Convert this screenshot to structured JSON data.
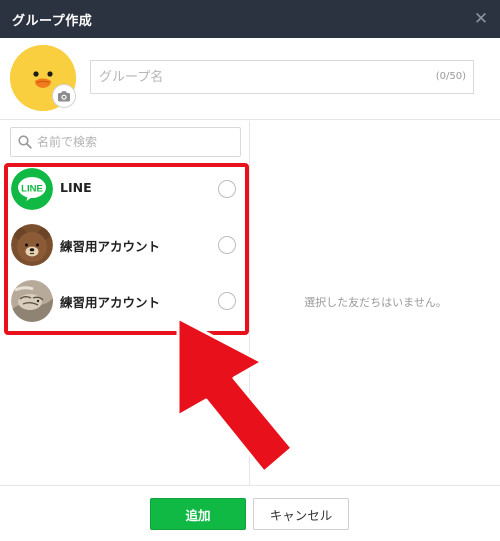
{
  "window": {
    "title": "グループ作成",
    "close_glyph": "✕"
  },
  "group": {
    "name_placeholder": "グループ名",
    "name_counter": "(0/50)",
    "avatar_icon": "sally-chick-icon",
    "camera_icon": "camera-icon"
  },
  "search": {
    "placeholder": "名前で検索",
    "icon": "search-icon"
  },
  "friends": [
    {
      "name": "LINE",
      "avatar": "line-logo-icon",
      "selected": false
    },
    {
      "name": "練習用アカウント",
      "avatar": "brown-bear-avatar",
      "selected": false
    },
    {
      "name": "練習用アカウント",
      "avatar": "cat-photo-avatar",
      "selected": false
    }
  ],
  "selected_panel": {
    "empty_text": "選択した友だちはいません。"
  },
  "footer": {
    "add_label": "追加",
    "cancel_label": "キャンセル"
  },
  "colors": {
    "titlebar": "#2c3340",
    "line_green": "#10b944",
    "annotation_red": "#e8101a",
    "sally_yellow": "#f9cf3f"
  }
}
